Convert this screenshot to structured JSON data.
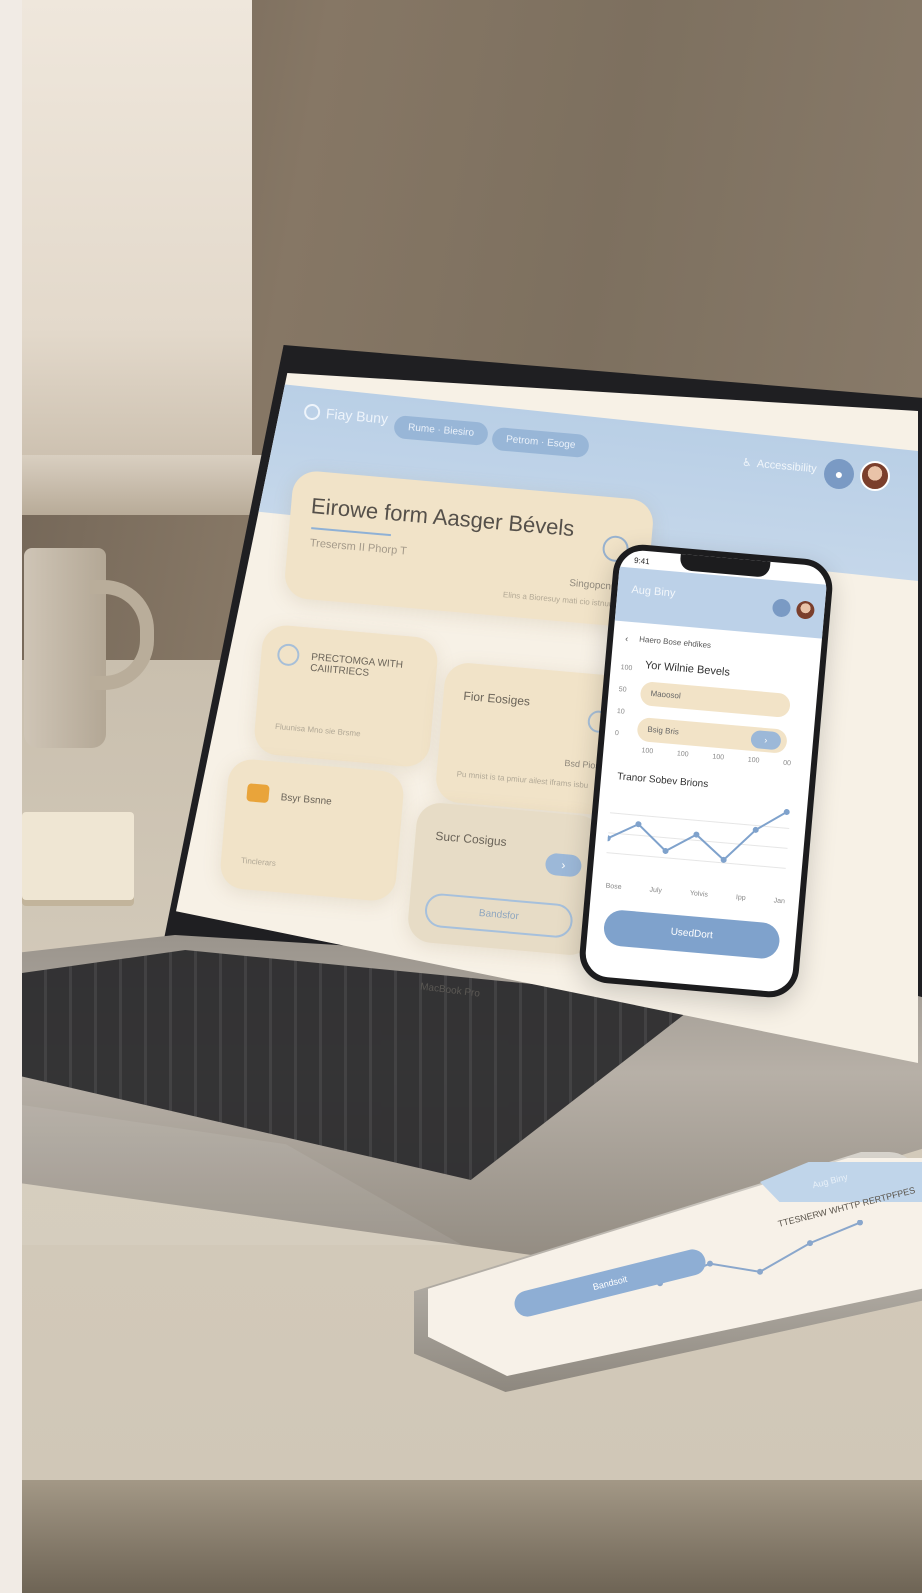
{
  "laptop": {
    "brand_label": "MacBook Pro"
  },
  "app": {
    "logo_text": "Fiay Buny",
    "nav": [
      "Rume · Biesiro",
      "Petrom · Esoge"
    ],
    "accessibility_label": "Accessibility"
  },
  "hero_card": {
    "title": "Eirowe form Aasger Bévels",
    "subtitle": "Tresersm II Phorp T",
    "meta": "Singopcnm",
    "note": "Elins a Bioresuy mati cio istnunes"
  },
  "cards": [
    {
      "title": "PRECTOMGA WITH CAIIITRIECS",
      "text": "Fluunisa Mno sie Brsme"
    },
    {
      "title": "Fior Eosiges",
      "right": "Bsd Pios",
      "text": "Pu mnist is ta pmiur ailest iframs isbu"
    },
    {
      "title": "Bsyr Bsnne",
      "text": "Tinclerars"
    },
    {
      "title": "Sucr Cosigus",
      "button": "Bandsfor",
      "arrow": "›"
    }
  ],
  "mini_phone": {
    "time": "9:41",
    "title": "Aug Biny",
    "back_label": "‹",
    "subtitle": "Haero Bose ehdikes",
    "heading": "Yor Wilnie Bevels",
    "y_axis": [
      "100",
      "50",
      "10",
      "0"
    ],
    "rows": [
      "Maoosol",
      "Bsig Bris"
    ],
    "x_ticks": [
      "100",
      "100",
      "100",
      "100",
      "00"
    ],
    "chart_title": "Tranor Sobev Brions",
    "months": [
      "Bose",
      "July",
      "Yolvis",
      "Ipp",
      "Jan"
    ],
    "cta": "UsedDort"
  },
  "real_phone": {
    "header": "Aug Biny",
    "card_title": "TTESNERW WHTTP RERTPFPES",
    "cta": "Bandsoit"
  },
  "colors": {
    "header_blue": "#bcd1e8",
    "card_cream": "#f1e3c8",
    "accent_blue": "#7fa2cc"
  },
  "chart_data": {
    "type": "line",
    "title": "Tranor Sobev Brions",
    "categories": [
      "Bose",
      "July",
      "Yolvis",
      "Ipp",
      "Jan"
    ],
    "series": [
      {
        "values": [
          40,
          62,
          30,
          55,
          25,
          68,
          95
        ]
      }
    ],
    "ylim": [
      0,
      100
    ]
  }
}
